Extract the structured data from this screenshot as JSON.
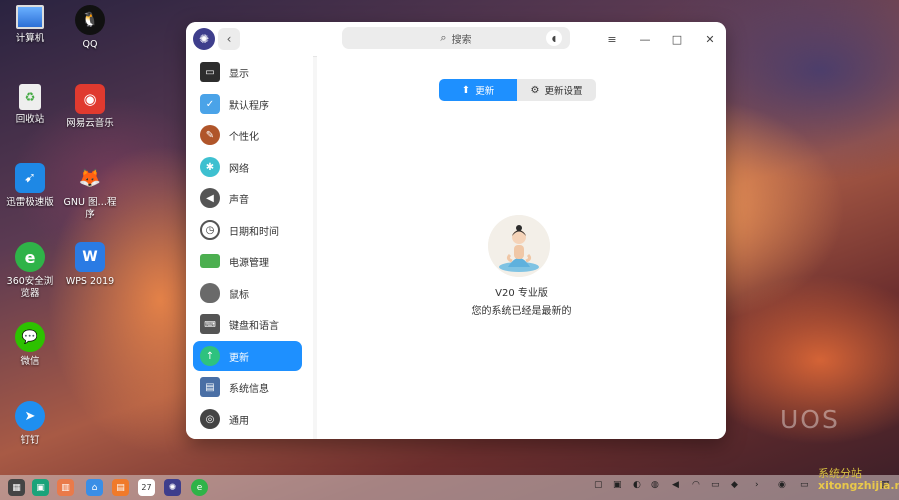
{
  "desktop": {
    "icons": [
      {
        "label": "计算机",
        "icon": "computer-icon"
      },
      {
        "label": "QQ",
        "icon": "qq-penguin-icon"
      },
      {
        "label": "回收站",
        "icon": "trash-icon"
      },
      {
        "label": "网易云音乐",
        "icon": "netease-music-icon"
      },
      {
        "label": "迅雷极速版",
        "icon": "thunder-icon"
      },
      {
        "label": "GNU 图…程序",
        "icon": "gimp-icon"
      },
      {
        "label": "360安全浏览器",
        "icon": "360-browser-icon"
      },
      {
        "label": "WPS 2019",
        "icon": "wps-icon"
      },
      {
        "label": "微信",
        "icon": "wechat-icon"
      },
      {
        "label": "钉钉",
        "icon": "dingtalk-icon"
      }
    ],
    "watermark_uos": "UOS",
    "watermark_site_cn": "系统分站",
    "watermark_site": "xitongzhijia.net"
  },
  "window": {
    "search_placeholder": "搜索",
    "sidebar": [
      {
        "label": "显示",
        "icon": "monitor-icon",
        "color": "#3a3a3a"
      },
      {
        "label": "默认程序",
        "icon": "default-apps-icon",
        "color": "#4aa3e8"
      },
      {
        "label": "个性化",
        "icon": "palette-icon",
        "color": "#b0552a"
      },
      {
        "label": "网络",
        "icon": "network-globe-icon",
        "color": "#3ec0d0"
      },
      {
        "label": "声音",
        "icon": "speaker-icon",
        "color": "#555555"
      },
      {
        "label": "日期和时间",
        "icon": "clock-icon",
        "color": "#777777"
      },
      {
        "label": "电源管理",
        "icon": "battery-icon",
        "color": "#4caf50"
      },
      {
        "label": "鼠标",
        "icon": "mouse-icon",
        "color": "#6a6a6a"
      },
      {
        "label": "键盘和语言",
        "icon": "keyboard-icon",
        "color": "#555555"
      },
      {
        "label": "更新",
        "icon": "update-arrow-icon",
        "color": "#2ec27e",
        "active": true
      },
      {
        "label": "系统信息",
        "icon": "system-info-icon",
        "color": "#4a6fa5"
      },
      {
        "label": "通用",
        "icon": "general-settings-icon",
        "color": "#444444"
      }
    ],
    "tabs": [
      {
        "label": "更新",
        "icon": "update-icon",
        "active": true
      },
      {
        "label": "更新设置",
        "icon": "gear-icon",
        "active": false
      }
    ],
    "version": "V20 专业版",
    "status": "您的系统已经是最新的"
  },
  "taskbar": {
    "apps": [
      "launcher-icon",
      "multitask-icon",
      "file-manager-icon",
      "app-store-icon",
      "calendar-icon",
      "control-center-icon",
      "360-browser-icon"
    ],
    "calendar_day": "27"
  }
}
